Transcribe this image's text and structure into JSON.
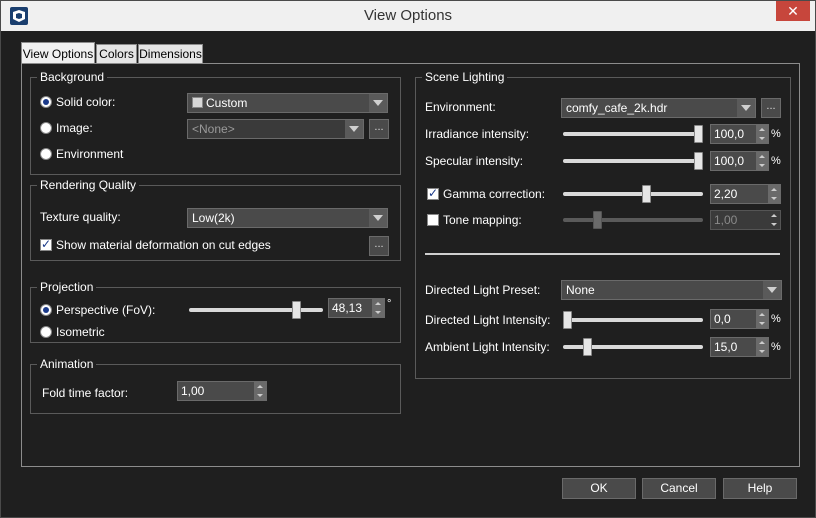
{
  "window": {
    "title": "View Options",
    "close_glyph": "✕"
  },
  "tabs": [
    {
      "label": "View Options",
      "active": true
    },
    {
      "label": "Colors",
      "active": false
    },
    {
      "label": "Dimensions",
      "active": false
    }
  ],
  "background": {
    "title": "Background",
    "solid_color_label": "Solid color:",
    "solid_color_value": "Custom",
    "image_label": "Image:",
    "image_value": "<None>",
    "environment_label": "Environment",
    "browse_label": "...",
    "selected": "solid"
  },
  "rendering": {
    "title": "Rendering Quality",
    "texture_label": "Texture quality:",
    "texture_value": "Low(2k)",
    "deform_label": "Show material deformation on cut edges",
    "deform_checked": true,
    "browse_label": "..."
  },
  "projection": {
    "title": "Projection",
    "perspective_label": "Perspective (FoV):",
    "perspective_value": "48,13",
    "perspective_fraction": 0.82,
    "degree_symbol": "°",
    "isometric_label": "Isometric",
    "selected": "perspective"
  },
  "animation": {
    "title": "Animation",
    "fold_label": "Fold time factor:",
    "fold_value": "1,00"
  },
  "lighting": {
    "title": "Scene Lighting",
    "environment_label": "Environment:",
    "environment_value": "comfy_cafe_2k.hdr",
    "browse_label": "...",
    "irradiance_label": "Irradiance intensity:",
    "irradiance_value": "100,0",
    "irradiance_fraction": 1.0,
    "specular_label": "Specular intensity:",
    "specular_value": "100,0",
    "specular_fraction": 1.0,
    "gamma_label": "Gamma correction:",
    "gamma_checked": true,
    "gamma_value": "2,20",
    "gamma_fraction": 0.6,
    "tone_label": "Tone mapping:",
    "tone_checked": false,
    "tone_value": "1,00",
    "tone_fraction": 0.23,
    "preset_label": "Directed Light Preset:",
    "preset_value": "None",
    "directed_label": "Directed Light Intensity:",
    "directed_value": "0,0",
    "directed_fraction": 0.0,
    "ambient_label": "Ambient Light Intensity:",
    "ambient_value": "15,0",
    "ambient_fraction": 0.15,
    "percent_symbol": "%"
  },
  "buttons": {
    "ok": "OK",
    "cancel": "Cancel",
    "help": "Help"
  }
}
